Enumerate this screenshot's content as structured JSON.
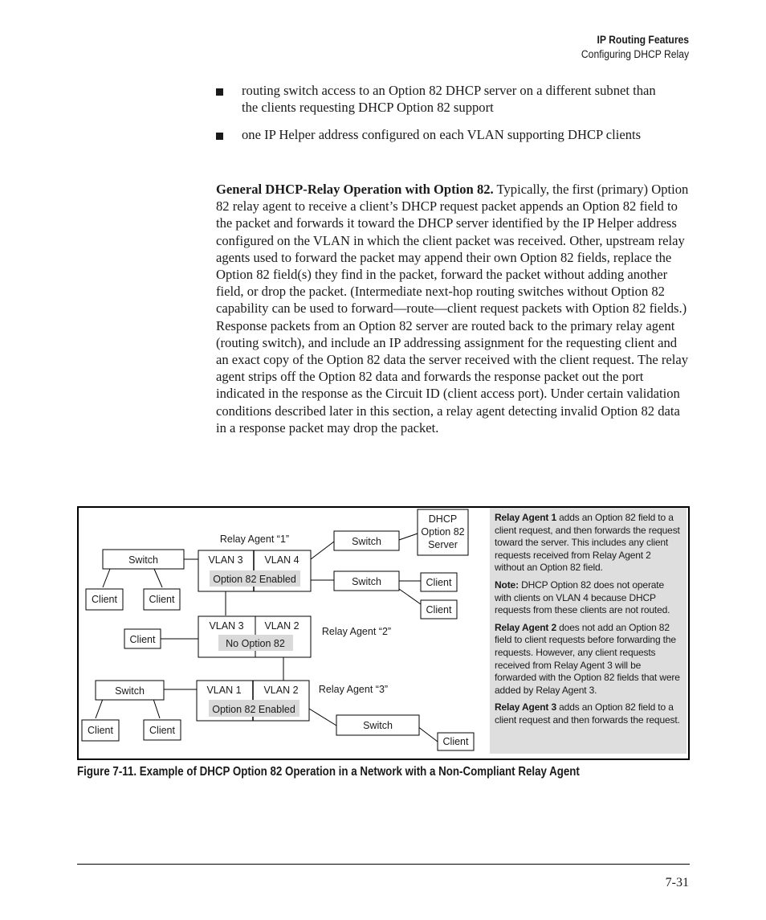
{
  "header": {
    "section": "IP Routing Features",
    "subsection": "Configuring DHCP Relay"
  },
  "bullets": [
    "routing switch access to an Option 82 DHCP server on a different subnet than the clients requesting DHCP Option 82 support",
    "one IP Helper address configured on each VLAN supporting DHCP clients"
  ],
  "paragraph": {
    "lead": "General DHCP-Relay Operation with Option 82.",
    "body": " Typically, the first (primary) Option 82 relay agent to receive a client’s DHCP request packet appends an Option 82 field to the packet and forwards it toward the DHCP server identified by the IP Helper address configured on the VLAN in which the client packet was received. Other, upstream relay agents used to forward the packet may append their own Option 82 fields, replace the Option 82 field(s) they find in the packet, forward the packet without adding another field,  or drop the packet. (Intermediate next-hop routing switches without Option 82 capability can be used to forward—route—client request packets with Option 82 fields.) Response packets from an Option 82 server are routed back to the primary relay agent (routing switch), and include an IP addressing assignment for the requesting client and an exact copy of the Option 82 data the server received with the client request. The relay agent strips off the Option 82 data and forwards the response packet out the port indicated in the response as the Circuit ID (client access port). Under certain validation conditions described later in this section, a relay agent detecting invalid Option 82 data in a response packet may drop the packet."
  },
  "diagram": {
    "switch_label": "Switch",
    "client_label": "Client",
    "server_label": [
      "DHCP",
      "Option 82",
      "Server"
    ],
    "agents": [
      {
        "name": "Relay Agent “1”",
        "left_vlan": "VLAN 3",
        "right_vlan": "VLAN 4",
        "status": "Option 82 Enabled"
      },
      {
        "name": "Relay Agent “2”",
        "left_vlan": "VLAN 3",
        "right_vlan": "VLAN 2",
        "status": "No Option 82"
      },
      {
        "name": "Relay Agent “3”",
        "left_vlan": "VLAN 1",
        "right_vlan": "VLAN 2",
        "status": "Option 82 Enabled"
      }
    ],
    "colors": {
      "status_fill": "#d9d9d9",
      "note_fill": "#dedede"
    }
  },
  "notes": [
    {
      "bold": "Relay Agent 1",
      "text": " adds an Option 82 field to a client request, and then forwards the request toward the server. This includes any client requests received from Relay Agent 2 without an Option 82 field."
    },
    {
      "bold": "Note:",
      "text": " DHCP Option 82 does not operate with clients on VLAN 4 because DHCP requests from these clients are not routed."
    },
    {
      "bold": "Relay Agent 2",
      "text": " does not add an Option 82 field to client requests before forwarding the requests. However, any client requests received from Relay Agent 3 will be forwarded with the Option 82 fields that were added by Relay Agent 3."
    },
    {
      "bold": "Relay Agent 3",
      "text": " adds an Option 82 field to a client request and then forwards the request."
    }
  ],
  "caption": "Figure 7-11.  Example of DHCP Option 82 Operation in a Network with a Non-Compliant Relay Agent",
  "page_number": "7-31"
}
